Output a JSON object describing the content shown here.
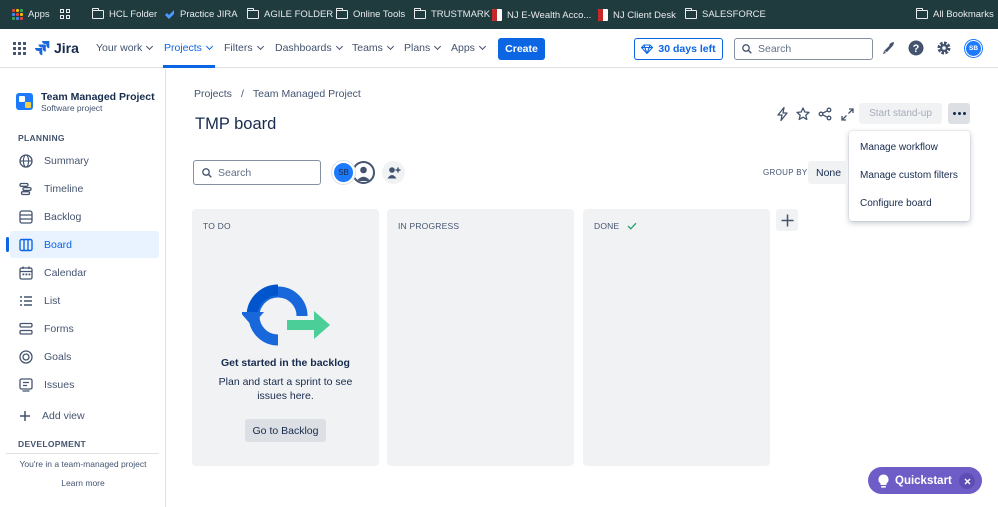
{
  "bookmarks": {
    "apps": "Apps",
    "items": [
      "HCL Folder",
      "Practice JIRA",
      "AGILE FOLDER",
      "Online Tools",
      "TRUSTMARK",
      "NJ E-Wealth Acco...",
      "NJ Client Desk",
      "SALESFORCE"
    ],
    "all_bookmarks": "All Bookmarks"
  },
  "topnav": {
    "logo": "Jira",
    "your_work": "Your work",
    "projects": "Projects",
    "filters": "Filters",
    "dashboards": "Dashboards",
    "teams": "Teams",
    "plans": "Plans",
    "apps": "Apps",
    "create": "Create",
    "trial": "30 days left",
    "search_placeholder": "Search",
    "avatar_initials": "SB"
  },
  "sidebar": {
    "project_name": "Team Managed Project",
    "project_type": "Software project",
    "planning_header": "PLANNING",
    "items": [
      {
        "label": "Summary",
        "icon": "globe-icon"
      },
      {
        "label": "Timeline",
        "icon": "timeline-icon"
      },
      {
        "label": "Backlog",
        "icon": "backlog-icon"
      },
      {
        "label": "Board",
        "icon": "board-icon"
      },
      {
        "label": "Calendar",
        "icon": "calendar-icon"
      },
      {
        "label": "List",
        "icon": "list-icon"
      },
      {
        "label": "Forms",
        "icon": "forms-icon"
      },
      {
        "label": "Goals",
        "icon": "goals-icon"
      },
      {
        "label": "Issues",
        "icon": "issues-icon"
      }
    ],
    "add_view": "Add view",
    "development_header": "DEVELOPMENT",
    "footer_text": "You're in a team-managed project",
    "learn_more": "Learn more"
  },
  "main": {
    "breadcrumb": [
      "Projects",
      "/",
      "Team Managed Project"
    ],
    "title": "TMP board",
    "start_standup": "Start stand-up",
    "menu": [
      "Manage workflow",
      "Manage custom filters",
      "Configure board"
    ],
    "search_placeholder": "Search",
    "avatar_initials": "SB",
    "group_by_label": "GROUP BY",
    "group_by_value": "None",
    "columns": [
      "TO DO",
      "IN PROGRESS",
      "DONE"
    ],
    "empty_title": "Get started in the backlog",
    "empty_desc": "Plan and start a sprint to see issues here.",
    "go_to_backlog": "Go to Backlog"
  },
  "quickstart": {
    "label": "Quickstart"
  },
  "colors": {
    "accent": "#0c66e4",
    "bookmark_bar": "#1f3b3e",
    "quickstart": "#6e5dc6",
    "selected_bg": "#e9f2ff"
  }
}
